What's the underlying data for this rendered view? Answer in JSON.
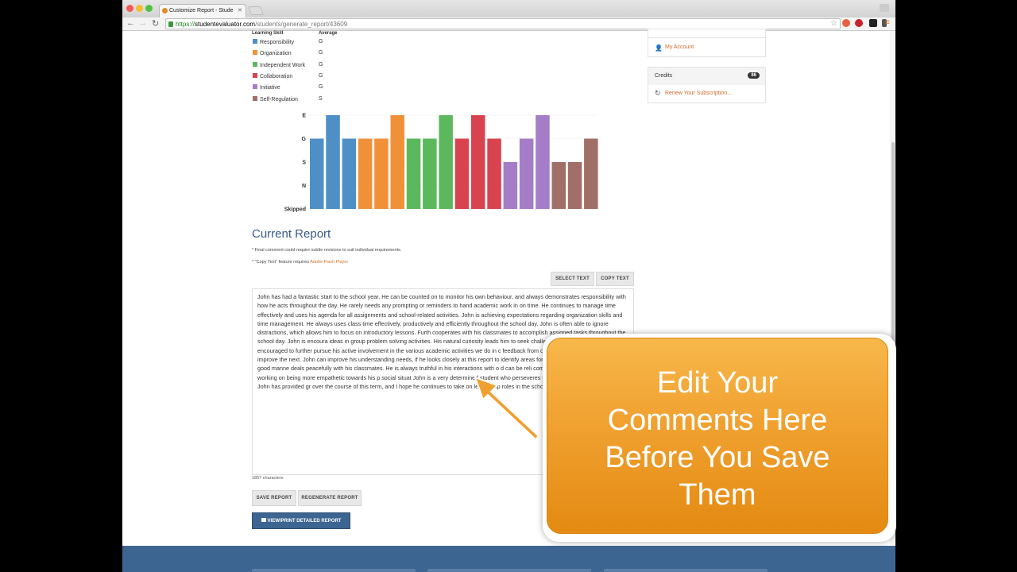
{
  "browser": {
    "tab_title": "Customize Report - Stude",
    "url_scheme": "https://",
    "url_domain": "studentevaluator.com",
    "url_path": "/students/generate_report/43609"
  },
  "skills": {
    "header_skill": "Learning Skill",
    "header_avg": "Average",
    "rows": [
      {
        "name": "Responsibility",
        "avg": "G",
        "color": "#4e8fc6"
      },
      {
        "name": "Organization",
        "avg": "G",
        "color": "#f0913a"
      },
      {
        "name": "Independent Work",
        "avg": "G",
        "color": "#5cb85c"
      },
      {
        "name": "Collaboration",
        "avg": "G",
        "color": "#d9434f"
      },
      {
        "name": "Initiative",
        "avg": "G",
        "color": "#a57cc8"
      },
      {
        "name": "Self-Regulation",
        "avg": "S",
        "color": "#a06f68"
      }
    ]
  },
  "chart_data": {
    "type": "bar",
    "y_levels": [
      "Skipped",
      "N",
      "S",
      "G",
      "E"
    ],
    "values": [
      3,
      4,
      3,
      3,
      3,
      4,
      3,
      3,
      4,
      3,
      4,
      3,
      2,
      3,
      4,
      2,
      2,
      3
    ],
    "colors": [
      "#4e8fc6",
      "#4e8fc6",
      "#4e8fc6",
      "#f0913a",
      "#f0913a",
      "#f0913a",
      "#5cb85c",
      "#5cb85c",
      "#5cb85c",
      "#d9434f",
      "#d9434f",
      "#d9434f",
      "#a57cc8",
      "#a57cc8",
      "#a57cc8",
      "#a06f68",
      "#a06f68",
      "#a06f68"
    ]
  },
  "report": {
    "title": "Current Report",
    "note1": "* Final comment could require subtle revisions to suit individual requirements.",
    "note2_prefix": "* \"Copy Text\" feature requires ",
    "note2_link": "Adobe Flash Player",
    "select_text": "SELECT TEXT",
    "copy_text": "COPY TEXT",
    "body": "John has had a fantastic start to the school year. He can be counted on to monitor his own behaviour, and always demonstrates responsibility with how he acts throughout the day. He rarely needs any prompting or reminders to hand academic work in on time. He continues to manage time effectively and uses his agenda for all assignments and school-related activities. John is achieving expectations regarding organization skills and time management. He always uses class time effectively, productively and efficiently throughout the school day. John is often able to ignore distractions, which allows him to focus on introductory lessons. Furth cooperates with his classmates to accomplish assigned tasks throughout the school day. John is encoura ideas in group problem solving activities. His natural curiosity leads him to seek challenging tasks and ta John is encouraged to further pursue his active involvement in the various academic activities we do in c feedback from one assignment, and applies it to improve the next. John can improve his understanding needs, if he looks closely at this report to identify areas for improvement. He demonstrates good manne deals peacefully with his classmates. He is always truthful in his interactions with o d can be reli commitments. He should continue working on being more empathetic towards his p social situat John is a very determined student who perseveres through academic challenges. John has provided gr over the course of this term, and I hope he continues to take on leadership roles in the school. Keep up",
    "char_count": "1857 characters",
    "save": "SAVE REPORT",
    "regenerate": "REGENERATE REPORT",
    "view_print": "VIEW/PRINT DETAILED REPORT"
  },
  "sidebar": {
    "my_account": "My Account",
    "credits_label": "Credits",
    "credits_count": "86",
    "renew": "Renew Your Subscription..."
  },
  "callout": {
    "line1": "Edit Your",
    "line2": "Comments Here",
    "line3": "Before You Save",
    "line4": "Them"
  }
}
